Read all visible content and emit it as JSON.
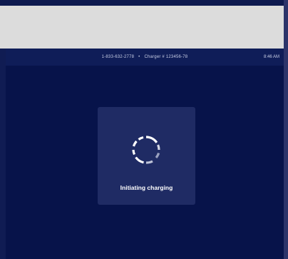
{
  "status_bar": {
    "phone": "1-833-632-2778",
    "separator": "•",
    "charger": "Charger # 123456-78",
    "time": "8:46 AM"
  },
  "dialog": {
    "spinner_icon": "loading-spinner-icon",
    "message": "Initiating charging"
  },
  "colors": {
    "background": "#07134a",
    "status_bar": "#0f1d58",
    "card": "#1f2b64",
    "spinner": "#ffffff"
  }
}
